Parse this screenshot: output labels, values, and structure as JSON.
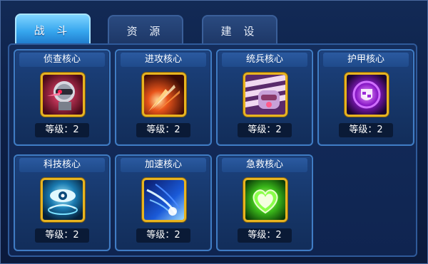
{
  "tabs": [
    {
      "label": "战 斗",
      "active": true
    },
    {
      "label": "资 源",
      "active": false
    },
    {
      "label": "建 设",
      "active": false
    }
  ],
  "cores": [
    {
      "name": "侦查核心",
      "level": "等级：2",
      "icon": "recon-robot-icon"
    },
    {
      "name": "进攻核心",
      "level": "等级：2",
      "icon": "attack-blast-icon"
    },
    {
      "name": "统兵核心",
      "level": "等级：2",
      "icon": "command-fist-icon"
    },
    {
      "name": "护甲核心",
      "level": "等级：2",
      "icon": "armor-shield-icon"
    },
    {
      "name": "科技核心",
      "level": "等级：2",
      "icon": "tech-eye-icon"
    },
    {
      "name": "加速核心",
      "level": "等级：2",
      "icon": "speed-streak-icon"
    },
    {
      "name": "急救核心",
      "level": "等级：2",
      "icon": "heal-heart-icon"
    }
  ]
}
